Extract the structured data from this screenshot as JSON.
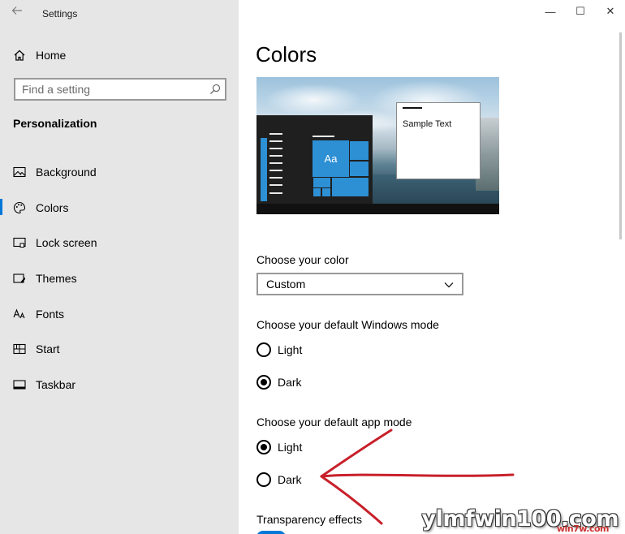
{
  "window": {
    "title": "Settings",
    "back_icon": "back-arrow-icon",
    "controls": {
      "minimize": "—",
      "maximize": "☐",
      "close": "✕"
    }
  },
  "sidebar": {
    "home_label": "Home",
    "search_placeholder": "Find a setting",
    "section_title": "Personalization",
    "items": [
      {
        "label": "Background",
        "icon": "picture-icon",
        "selected": false
      },
      {
        "label": "Colors",
        "icon": "palette-icon",
        "selected": true
      },
      {
        "label": "Lock screen",
        "icon": "lock-screen-icon",
        "selected": false
      },
      {
        "label": "Themes",
        "icon": "themes-icon",
        "selected": false
      },
      {
        "label": "Fonts",
        "icon": "fonts-icon",
        "selected": false
      },
      {
        "label": "Start",
        "icon": "start-icon",
        "selected": false
      },
      {
        "label": "Taskbar",
        "icon": "taskbar-icon",
        "selected": false
      }
    ]
  },
  "main": {
    "title": "Colors",
    "preview": {
      "tile_label": "Aa",
      "sample_text": "Sample Text"
    },
    "choose_color": {
      "label": "Choose your color",
      "value": "Custom"
    },
    "windows_mode": {
      "label": "Choose your default Windows mode",
      "options": [
        {
          "label": "Light",
          "checked": false
        },
        {
          "label": "Dark",
          "checked": true
        }
      ]
    },
    "app_mode": {
      "label": "Choose your default app mode",
      "options": [
        {
          "label": "Light",
          "checked": true
        },
        {
          "label": "Dark",
          "checked": false
        }
      ]
    },
    "transparency": {
      "label": "Transparency effects"
    }
  },
  "watermark": {
    "text": "ylmfwin100.com",
    "sub": "win7w.com"
  },
  "colors": {
    "accent": "#0078d7",
    "sidebar_bg": "#e6e6e6",
    "annotation": "#c8202a"
  }
}
